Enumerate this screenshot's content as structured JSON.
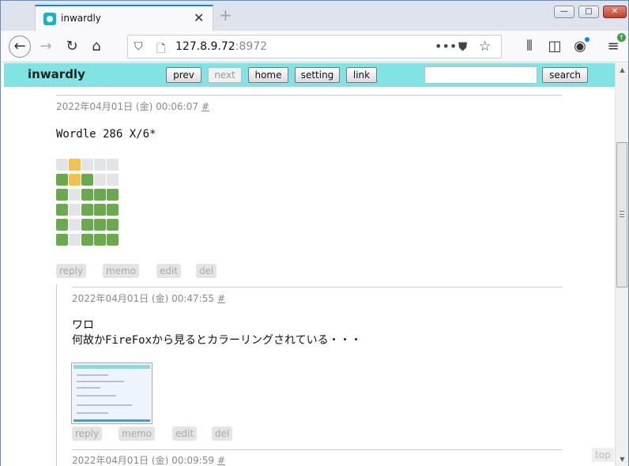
{
  "browser": {
    "tab_title": "inwardly",
    "tab_close": "✕",
    "new_tab": "+",
    "url_host": "127.8.9.72",
    "url_port": ":8972",
    "window_buttons": [
      "minimize",
      "maximize",
      "close"
    ],
    "icons": [
      "back-icon",
      "forward-icon",
      "reload-icon",
      "home-icon",
      "shield-icon",
      "page-icon",
      "page-actions-icon",
      "pocket-icon",
      "bookmark-star-icon",
      "library-icon",
      "sidebar-icon",
      "account-icon",
      "menu-icon"
    ]
  },
  "site": {
    "brand": "inwardly",
    "buttons": {
      "prev": "prev",
      "next": "next",
      "home": "home",
      "setting": "setting",
      "link": "link",
      "search": "search"
    },
    "search_value": ""
  },
  "post": {
    "meta": "2022年04月01日 (金) 00:06:07",
    "permalink": "#",
    "text": "Wordle 286 X/6*",
    "wordle_grid": [
      [
        "empty",
        "yellow",
        "empty",
        "empty",
        "empty"
      ],
      [
        "green",
        "yellow",
        "green",
        "empty",
        "empty"
      ],
      [
        "green",
        "empty",
        "green",
        "green",
        "green"
      ],
      [
        "green",
        "empty",
        "green",
        "green",
        "green"
      ],
      [
        "green",
        "empty",
        "green",
        "green",
        "green"
      ],
      [
        "green",
        "empty",
        "green",
        "green",
        "green"
      ]
    ],
    "grid_colors": {
      "green": "#6aaa4f",
      "yellow": "#f5c14e",
      "empty": "#e2e4e5"
    },
    "actions": [
      "reply",
      "memo",
      "edit",
      "del"
    ]
  },
  "reply1": {
    "meta": "2022年04月01日 (金) 00:47:55",
    "permalink": "#",
    "line1": "ワロ",
    "line2": "何故かFireFoxから見るとカラーリングされている・・・",
    "actions": [
      "reply",
      "memo",
      "edit",
      "del"
    ]
  },
  "reply2": {
    "meta": "2022年04月01日 (金) 00:09:59",
    "permalink": "#"
  },
  "top_link": "top",
  "colors": {
    "site_bar": "#80e4e4",
    "tab_accent": "#0a84ff"
  }
}
